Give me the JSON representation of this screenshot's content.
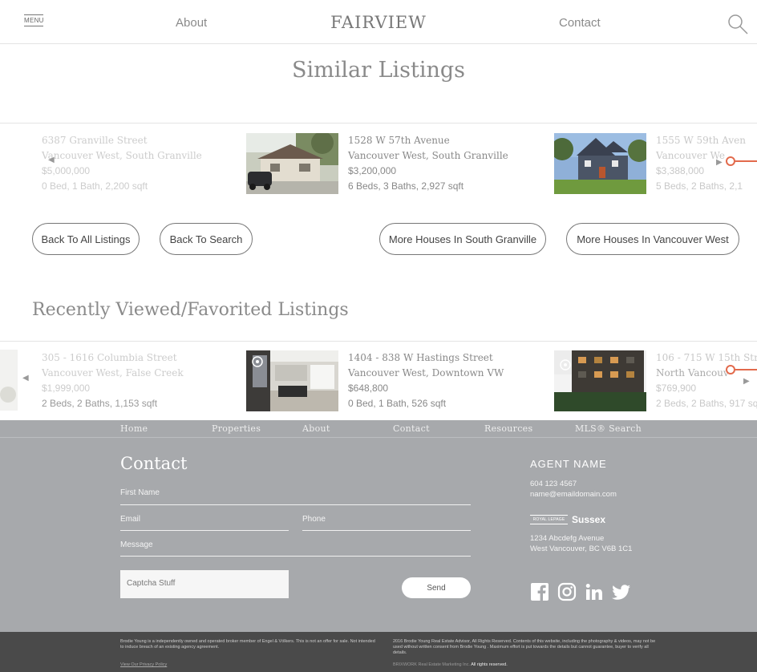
{
  "header": {
    "menu_label": "MENU",
    "about": "About",
    "brand": "FAIRVIEW",
    "contact": "Contact",
    "search_icon": "search-icon"
  },
  "similar": {
    "title": "Similar Listings",
    "listings": [
      {
        "address": "6387 Granville Street",
        "area": "Vancouver West, South Granville",
        "price": "$5,000,000",
        "details": "0 Bed, 1 Bath, 2,200 sqft"
      },
      {
        "address": "1528 W 57th Avenue",
        "area": "Vancouver West, South Granville",
        "price": "$3,200,000",
        "details": "6 Beds, 3 Baths, 2,927 sqft"
      },
      {
        "address": "1555 W 59th Aven",
        "area": "Vancouver We",
        "price": "$3,388,000",
        "details": "5 Beds, 2 Baths, 2,1"
      }
    ]
  },
  "buttons": {
    "back_all": "Back To All Listings",
    "back_search": "Back To Search",
    "more_area": "More Houses In South Granville",
    "more_region": "More Houses In Vancouver West"
  },
  "recent": {
    "title": "Recently Viewed/Favorited Listings",
    "listings": [
      {
        "address": "305 - 1616 Columbia Street",
        "area": "Vancouver West, False Creek",
        "price": "$1,999,000",
        "details": "2 Beds, 2 Baths, 1,153 sqft"
      },
      {
        "address": "1404 - 838 W Hastings Street",
        "area": "Vancouver West, Downtown VW",
        "price": "$648,800",
        "details": "0 Bed, 1 Bath, 526 sqft"
      },
      {
        "address": "106 - 715 W 15th Stree",
        "area": "North Vancouv",
        "price": "$769,900",
        "details": "2 Beds, 2 Baths, 917 sqf"
      }
    ]
  },
  "footer": {
    "nav": [
      "Home",
      "Properties",
      "About",
      "Contact",
      "Resources",
      "MLS® Search"
    ],
    "contact_title": "Contact",
    "first_name": "First Name",
    "email": "Email",
    "phone": "Phone",
    "message": "Message",
    "captcha": "Captcha Stuff",
    "send": "Send",
    "agent_name": "AGENT NAME",
    "agent_phone": "604 123 4567",
    "agent_email": "name@emaildomain.com",
    "brokerage_logo": "ROYAL LEPAGE",
    "brokerage": "Sussex",
    "address1": "1234 Abcdefg Avenue",
    "address2": "West Vancouver, BC  V6B 1C1",
    "social": [
      "facebook-icon",
      "instagram-icon",
      "linkedin-icon",
      "twitter-icon"
    ]
  },
  "legal": {
    "left": "Brodie Young is a independently owned and operated broker member of Engel & Völkers. This is not an offer for sale. Not intended to induce breach of an existing agency agreement.",
    "privacy": "View Our Privacy Policy",
    "right": "2016 Brodie Young Real Estate Advisor, All Rights Reserved. Contents of this website, including the photography & videos, may not be used without written consent from Brodie Young . Maximum effort is put towards the details but cannot guarantee, buyer to verify all details.",
    "credit": "BRIXWORK Real Estate Marketing Inc.",
    "credit_suffix": "All rights reserved."
  }
}
